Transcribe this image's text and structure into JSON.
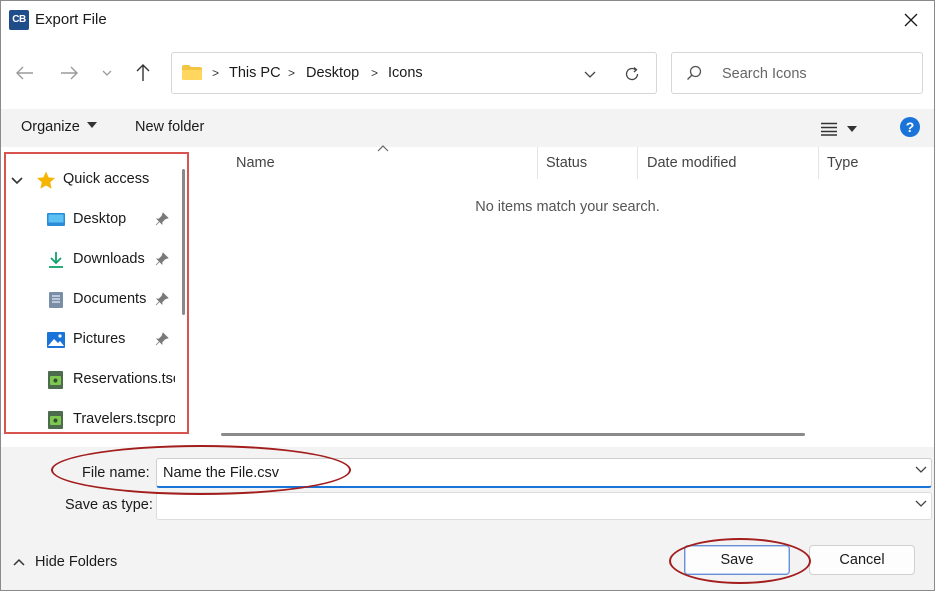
{
  "window": {
    "app_logo": "CB",
    "title": "Export File",
    "close_icon": "close-icon"
  },
  "nav": {
    "back_icon": "arrow-left-icon",
    "forward_icon": "arrow-right-icon",
    "recent_icon": "chevron-down-icon",
    "up_icon": "arrow-up-icon",
    "breadcrumbs": [
      "This PC",
      "Desktop",
      "Icons"
    ],
    "search_placeholder": "Search Icons"
  },
  "commands": {
    "organize": "Organize",
    "new_folder": "New folder",
    "help": "?"
  },
  "sidebar": {
    "quick_access": "Quick access",
    "items": [
      {
        "label": "Desktop",
        "icon": "desktop-icon",
        "pinned": true
      },
      {
        "label": "Downloads",
        "icon": "download-icon",
        "pinned": true
      },
      {
        "label": "Documents",
        "icon": "document-icon",
        "pinned": true
      },
      {
        "label": "Pictures",
        "icon": "picture-icon",
        "pinned": true
      },
      {
        "label": "Reservations.tscproj",
        "icon": "project-file-icon",
        "pinned": false
      },
      {
        "label": "Travelers.tscproj",
        "icon": "project-file-icon",
        "pinned": false
      }
    ]
  },
  "files": {
    "columns": [
      "Name",
      "Status",
      "Date modified",
      "Type"
    ],
    "empty_message": "No items match your search."
  },
  "form": {
    "file_name_label": "File name:",
    "file_name_value": "Name the File.csv",
    "save_type_label": "Save as type:",
    "save_type_value": ""
  },
  "footer": {
    "hide_folders": "Hide Folders",
    "save": "Save",
    "cancel": "Cancel"
  },
  "colors": {
    "accent": "#1a73d9",
    "annotation_red": "#a31d1d",
    "sidebar_highlight": "#d9534f"
  }
}
